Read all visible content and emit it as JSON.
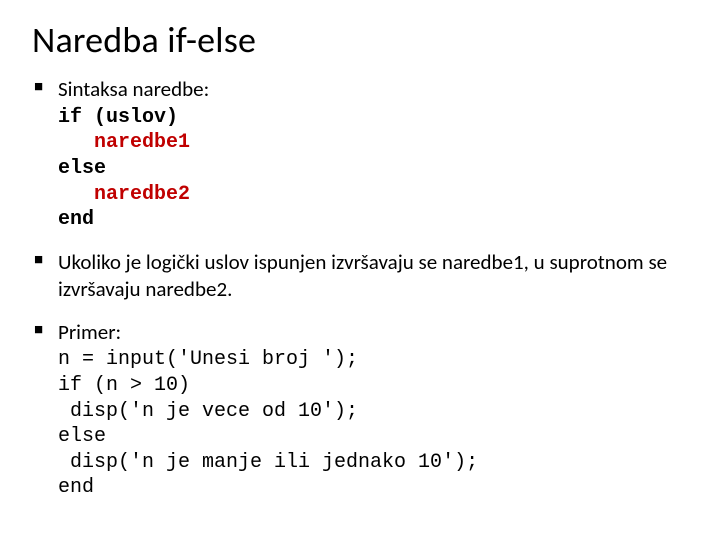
{
  "title": "Naredba if-else",
  "bullets": {
    "b1": {
      "lead": "Sintaksa naredbe:",
      "code": {
        "kw_if": "if",
        "cond": " (uslov)",
        "n1": "naredbe1",
        "kw_else": "else",
        "n2": "naredbe2",
        "kw_end": "end"
      }
    },
    "b2": {
      "t1": "Ukoliko je logički uslov ispunjen izvršavaju se ",
      "n1": "naredbe1",
      "t2": ", u suprotnom se izvršavaju ",
      "n2": "naredbe2",
      "t3": "."
    },
    "b3": {
      "lead": "Primer:",
      "code": {
        "l1": "n = input('Unesi broj ');",
        "l2": "if (n > 10)",
        "l3": " disp('n je vece od 10');",
        "l4": "else",
        "l5": " disp('n je manje ili jednako 10');",
        "l6": "end"
      }
    }
  }
}
